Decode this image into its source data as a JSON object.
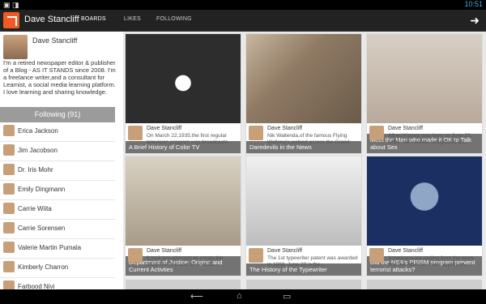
{
  "status": {
    "time": "10:51"
  },
  "actionbar": {
    "title": "Dave Stancliff",
    "tabs": [
      "BOARDS",
      "LIKES",
      "FOLLOWING"
    ]
  },
  "profile": {
    "name": "Dave Stancliff",
    "bio": "I'm a retired newspaper editor & publisher of a Blog - AS IT STANDS since 2008. I'm a freelance writer,and a consultant for Learnist, a social media learning platform. I love learning and sharing knowledge."
  },
  "following": {
    "header": "Following (91)",
    "people": [
      "Erica Jackson",
      "Jim Jacobson",
      "Dr. Iris Mohr",
      "Emily Dingmann",
      "Carrie Wiita",
      "Carrie Sorensen",
      "Valerie Martin Pumala",
      "Kimberly Charron",
      "Farbood Nivi"
    ]
  },
  "cards": [
    {
      "title": "A Brief History of Color TV",
      "author": "Dave Stancliff",
      "desc": "On March 22,1935,the first regular television program was broadcaste..."
    },
    {
      "title": "Daredevils in the News",
      "author": "Dave Stancliff",
      "desc": "Nik Wallenda,of the famous Flying Wallena's,walked across the Grand..."
    },
    {
      "title": "Meet the Man who made it OK to Talk about Sex",
      "author": "Dave Stancliff",
      "desc": "Alfred Kinsey, was born on June 23, 1894. He's widely recognized as..."
    },
    {
      "title": "Department of Justice: Origins and Current Activties",
      "author": "Dave Stancliff",
      "desc": "It took two attempts to create the DOJ.The 2nd one on Feb.25,..."
    },
    {
      "title": "The History of the Typewriter",
      "author": "Dave Stancliff",
      "desc": "The 1st typewriter patent was awarded in 1868. June 23 is the..."
    },
    {
      "title": "Did the NSA's PRISM program prevent terrorist attacks?",
      "author": "Dave Stancliff",
      "desc": "Americans are reeling from the news that the NSA has been spying on..."
    }
  ],
  "colors": {
    "accent": "#f15a24",
    "status_icons": "#33b5e5"
  },
  "icons": {
    "back": "back-icon",
    "home": "home-icon",
    "recents": "recents-icon",
    "next": "arrow-right-icon"
  }
}
